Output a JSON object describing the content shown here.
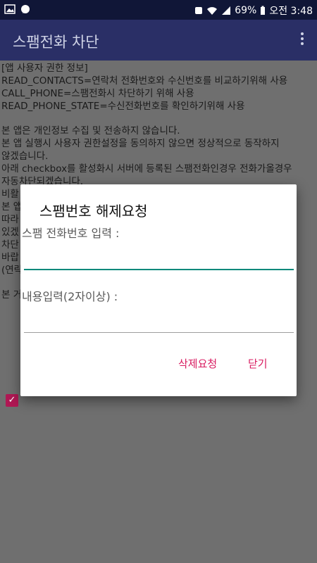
{
  "status_bar": {
    "battery_text": "69%",
    "time_text": "오전 3:48"
  },
  "app_bar": {
    "title": "스팸전화 차단"
  },
  "background_text": {
    "lines": [
      "[앱 사용자 권한 정보]",
      " READ_CONTACTS=연락처 전화번호와 수신번호를 비교하기위해 사용",
      " CALL_PHONE=스팸전화시 차단하기 위해 사용",
      " READ_PHONE_STATE=수신전화번호를 확인하기위해 사용",
      "",
      " 본 앱은 개인정보 수집 및 전송하지 않습니다.",
      " 본 앱 실행시 사용자 권한설정을 동의하지 않으면 정상적으로 동작하지",
      "않겠습니다.",
      " 아래 checkbox를 활성화시 서버에 등록된 스팸전화인경우 전화가올경우",
      "자동차단되겠습니다.",
      " 비활",
      " 본 앱",
      "따라",
      "있겠",
      " 차단",
      "바랍",
      "(연락",
      "",
      "본 거"
    ]
  },
  "dialog": {
    "title": "스팸번호 해제요청",
    "phone_label": "스팸 전화번호 입력 :",
    "phone_value": "",
    "content_label": "내용입력(2자이상) :",
    "content_value": "",
    "request_delete": "삭제요청",
    "close": "닫기"
  }
}
